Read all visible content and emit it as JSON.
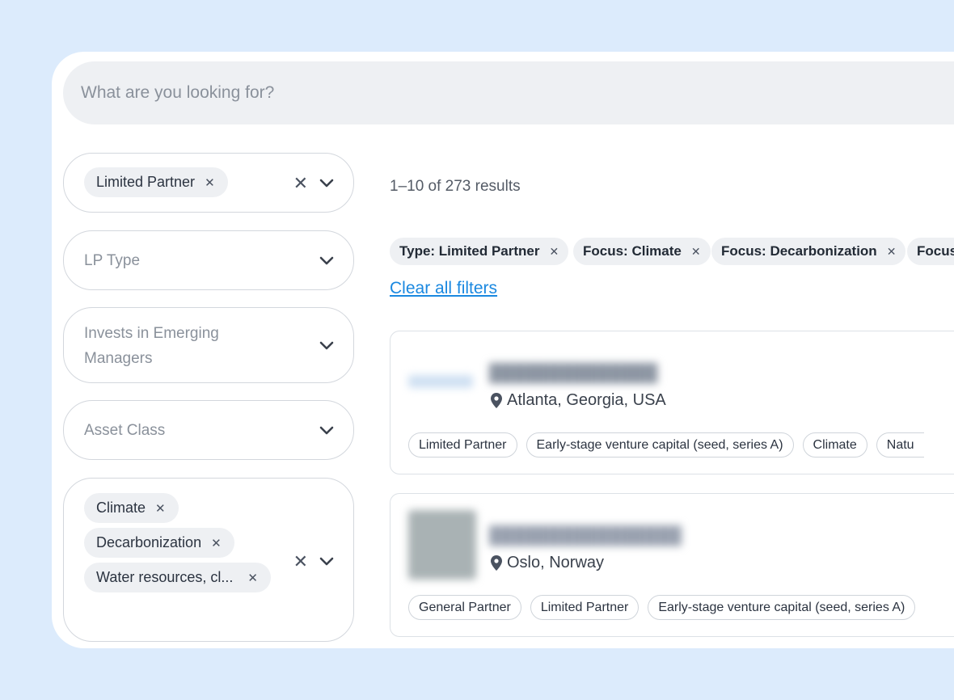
{
  "search": {
    "placeholder": "What are you looking for?"
  },
  "filters": {
    "role": {
      "chips": [
        "Limited Partner"
      ]
    },
    "lp_type": {
      "placeholder": "LP Type"
    },
    "emerging": {
      "placeholder": "Invests in Emerging Managers",
      "line1": "Invests in Emerging",
      "line2": "Managers"
    },
    "asset_class": {
      "placeholder": "Asset Class"
    },
    "focus": {
      "chips": [
        "Climate",
        "Decarbonization",
        "Water resources, cl..."
      ]
    }
  },
  "results": {
    "count_text": "1–10 of 273 results",
    "active_filters": [
      "Type: Limited Partner",
      "Focus: Climate",
      "Focus: Decarbonization",
      "Focus"
    ],
    "clear_all": "Clear all filters",
    "items": [
      {
        "location": "Atlanta, Georgia, USA",
        "tags": [
          "Limited Partner",
          "Early-stage venture capital (seed, series A)",
          "Climate",
          "Natu"
        ]
      },
      {
        "location": "Oslo, Norway",
        "tags": [
          "General Partner",
          "Limited Partner",
          "Early-stage venture capital (seed, series A)"
        ]
      }
    ]
  },
  "colors": {
    "background": "#dcebfc",
    "link": "#1a88e0",
    "chip_bg": "#eef0f3"
  }
}
